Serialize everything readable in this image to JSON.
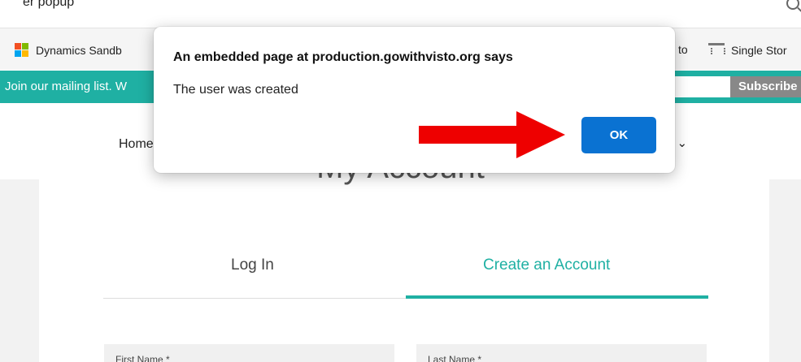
{
  "browser": {
    "top_caption": "er popup"
  },
  "bookmarks": {
    "items": [
      {
        "label": "Dynamics Sandb",
        "icon": "microsoft-logo-icon"
      },
      {
        "label": "to",
        "icon": ""
      },
      {
        "label": "Single Stor",
        "icon": "store-icon"
      }
    ]
  },
  "mailing": {
    "text": "Join our mailing list. W",
    "subscribe_label": "Subscribe"
  },
  "nav": {
    "home": "Home",
    "chevron": "n ⌄"
  },
  "page": {
    "title": "My Account",
    "tabs": [
      {
        "label": "Log In",
        "active": false
      },
      {
        "label": "Create an Account",
        "active": true
      }
    ],
    "fields": [
      {
        "label": "First Name *"
      },
      {
        "label": "Last Name *"
      }
    ]
  },
  "dialog": {
    "title": "An embedded page at production.gowithvisto.org says",
    "message": "The user was created",
    "ok_label": "OK"
  },
  "colors": {
    "teal": "#1fb0a3",
    "ok_button": "#0a72d2",
    "arrow": "#ee0000",
    "subscribe": "#888888"
  }
}
